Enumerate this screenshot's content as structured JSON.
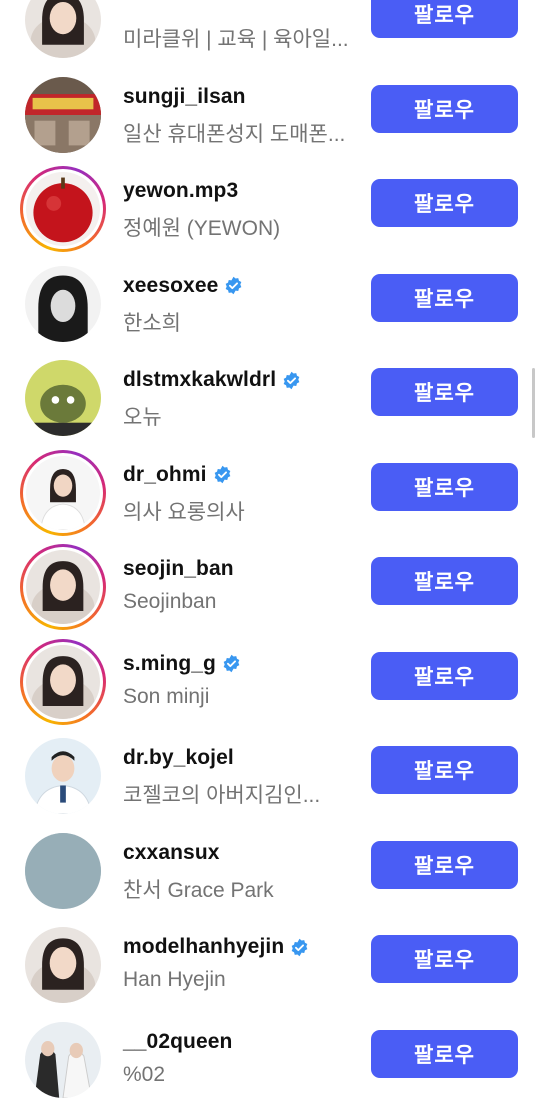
{
  "follow_label": "팔로우",
  "accounts": [
    {
      "username": "",
      "subtitle": "미라클위 | 교육 | 육아일...",
      "verified": false,
      "ring": false,
      "icon": "avatar-woman-portrait"
    },
    {
      "username": "sungji_ilsan",
      "subtitle": "일산 휴대폰성지 도매폰...",
      "verified": false,
      "ring": false,
      "icon": "avatar-storefront"
    },
    {
      "username": "yewon.mp3",
      "subtitle": "정예원 (YEWON)",
      "verified": false,
      "ring": true,
      "icon": "avatar-red-apple"
    },
    {
      "username": "xeesoxee",
      "subtitle": "한소희",
      "verified": true,
      "ring": false,
      "icon": "avatar-bw-portrait"
    },
    {
      "username": "dlstmxkakwldrl",
      "subtitle": "오뉴",
      "verified": true,
      "ring": false,
      "icon": "avatar-cartoon-green"
    },
    {
      "username": "dr_ohmi",
      "subtitle": "의사 요롱의사",
      "verified": true,
      "ring": true,
      "icon": "avatar-doctor-woman"
    },
    {
      "username": "seojin_ban",
      "subtitle": "Seojinban",
      "verified": false,
      "ring": true,
      "icon": "avatar-woman-portrait"
    },
    {
      "username": "s.ming_g",
      "subtitle": "Son minji",
      "verified": true,
      "ring": true,
      "icon": "avatar-woman-portrait"
    },
    {
      "username": "dr.by_kojel",
      "subtitle": "코젤코의 아버지김인...",
      "verified": false,
      "ring": false,
      "icon": "avatar-doctor-man"
    },
    {
      "username": "cxxansux",
      "subtitle": "찬서 Grace Park",
      "verified": false,
      "ring": false,
      "icon": "avatar-plain-teal"
    },
    {
      "username": "modelhanhyejin",
      "subtitle": "Han Hyejin",
      "verified": true,
      "ring": false,
      "icon": "avatar-woman-portrait"
    },
    {
      "username": "__02queen",
      "subtitle": "%02",
      "verified": false,
      "ring": false,
      "icon": "avatar-couple-photo"
    }
  ]
}
